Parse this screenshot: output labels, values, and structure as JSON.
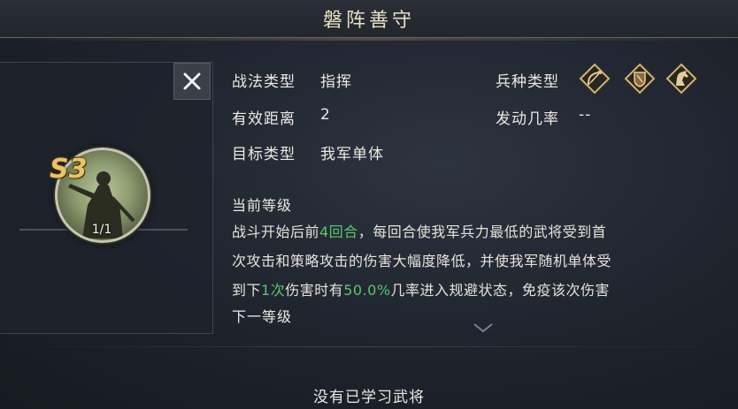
{
  "title": "磐阵善守",
  "skill": {
    "grade": "S3",
    "level_count": "1/1"
  },
  "fields": {
    "tactic_type_label": "战法类型",
    "tactic_type_value": "指挥",
    "range_label": "有效距离",
    "range_value": "2",
    "target_label": "目标类型",
    "target_value": "我军单体",
    "troop_type_label": "兵种类型",
    "trigger_rate_label": "发动几率",
    "trigger_rate_value": "--"
  },
  "troop_icons": [
    "archer-icon",
    "shield-icon",
    "cavalry-icon"
  ],
  "current_level": {
    "label": "当前等级",
    "line1_a": "战斗开始后前",
    "line1_b": "4回合",
    "line1_c": "，每回合使我军兵力最低的武将受到首",
    "line2": "次攻击和策略攻击的伤害大幅度降低，并使我军随机单体受",
    "line3_a": "到下",
    "line3_b": "1次",
    "line3_c": "伤害时有",
    "line3_d": "50.0%",
    "line3_e": "几率进入规避状态，免疫该次伤害"
  },
  "next_level_label": "下一等级",
  "footer_text": "没有已学习武将",
  "colors": {
    "highlight": "#58c86a",
    "title": "#e9e2c6",
    "grade": "#e7c46a"
  }
}
